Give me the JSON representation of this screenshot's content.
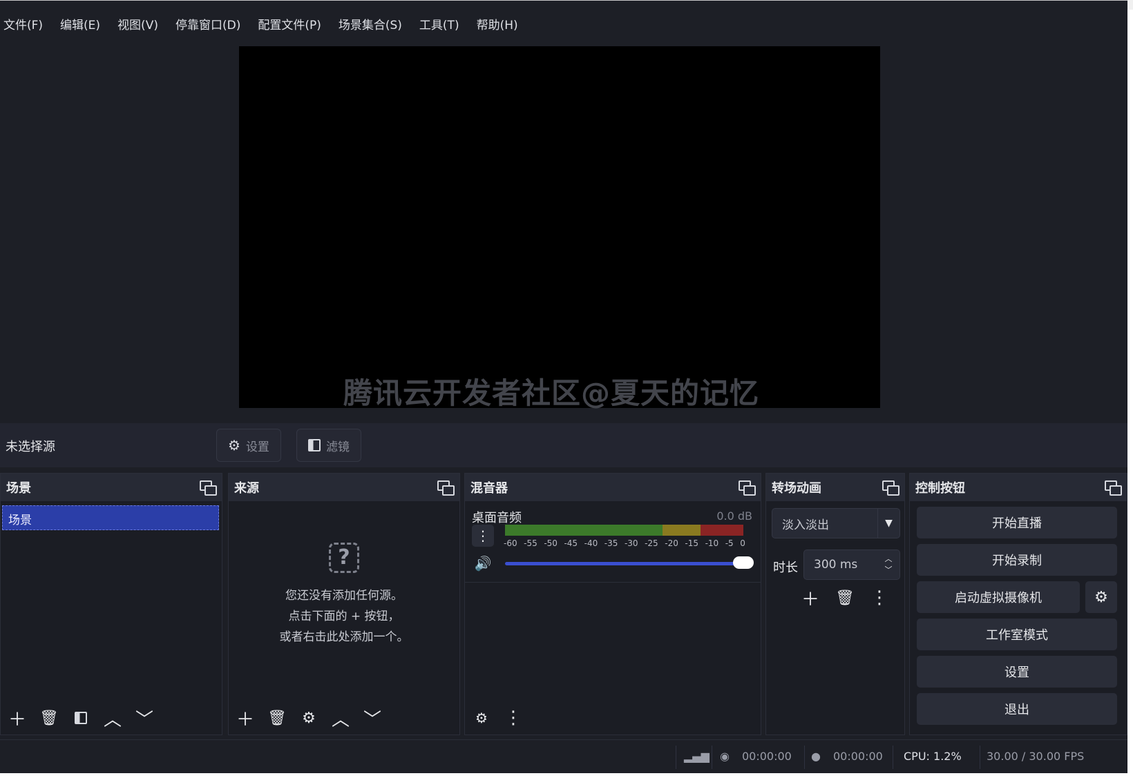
{
  "menu": [
    "文件(F)",
    "编辑(E)",
    "视图(V)",
    "停靠窗口(D)",
    "配置文件(P)",
    "场景集合(S)",
    "工具(T)",
    "帮助(H)"
  ],
  "watermark": "腾讯云开发者社区@夏天的记忆",
  "source_toolbar": {
    "no_source": "未选择源",
    "settings_label": "设置",
    "filters_label": "滤镜"
  },
  "scenes": {
    "title": "场景",
    "items": [
      "场景"
    ]
  },
  "sources": {
    "title": "来源",
    "empty_lines": [
      "您还没有添加任何源。",
      "点击下面的 + 按钮，",
      "或者右击此处添加一个。"
    ]
  },
  "mixer": {
    "title": "混音器",
    "channel_name": "桌面音频",
    "channel_db": "0.0 dB",
    "meter_ticks": [
      "-60",
      "-55",
      "-50",
      "-45",
      "-40",
      "-35",
      "-30",
      "-25",
      "-20",
      "-15",
      "-10",
      "-5",
      "0"
    ],
    "volume_fraction": 1.0
  },
  "transitions": {
    "title": "转场动画",
    "selected": "淡入淡出",
    "duration_label": "时长",
    "duration_value": "300 ms"
  },
  "controls": {
    "title": "控制按钮",
    "buttons": [
      "开始直播",
      "开始录制",
      "启动虚拟摄像机",
      "工作室模式",
      "设置",
      "退出"
    ]
  },
  "status": {
    "stream_time": "00:00:00",
    "record_time": "00:00:00",
    "cpu": "CPU: 1.2%",
    "fps": "30.00 / 30.00 FPS"
  },
  "colors": {
    "background": "#1d1f26",
    "selection": "#2b3ea8",
    "volume_accent": "#3a4fd0"
  }
}
